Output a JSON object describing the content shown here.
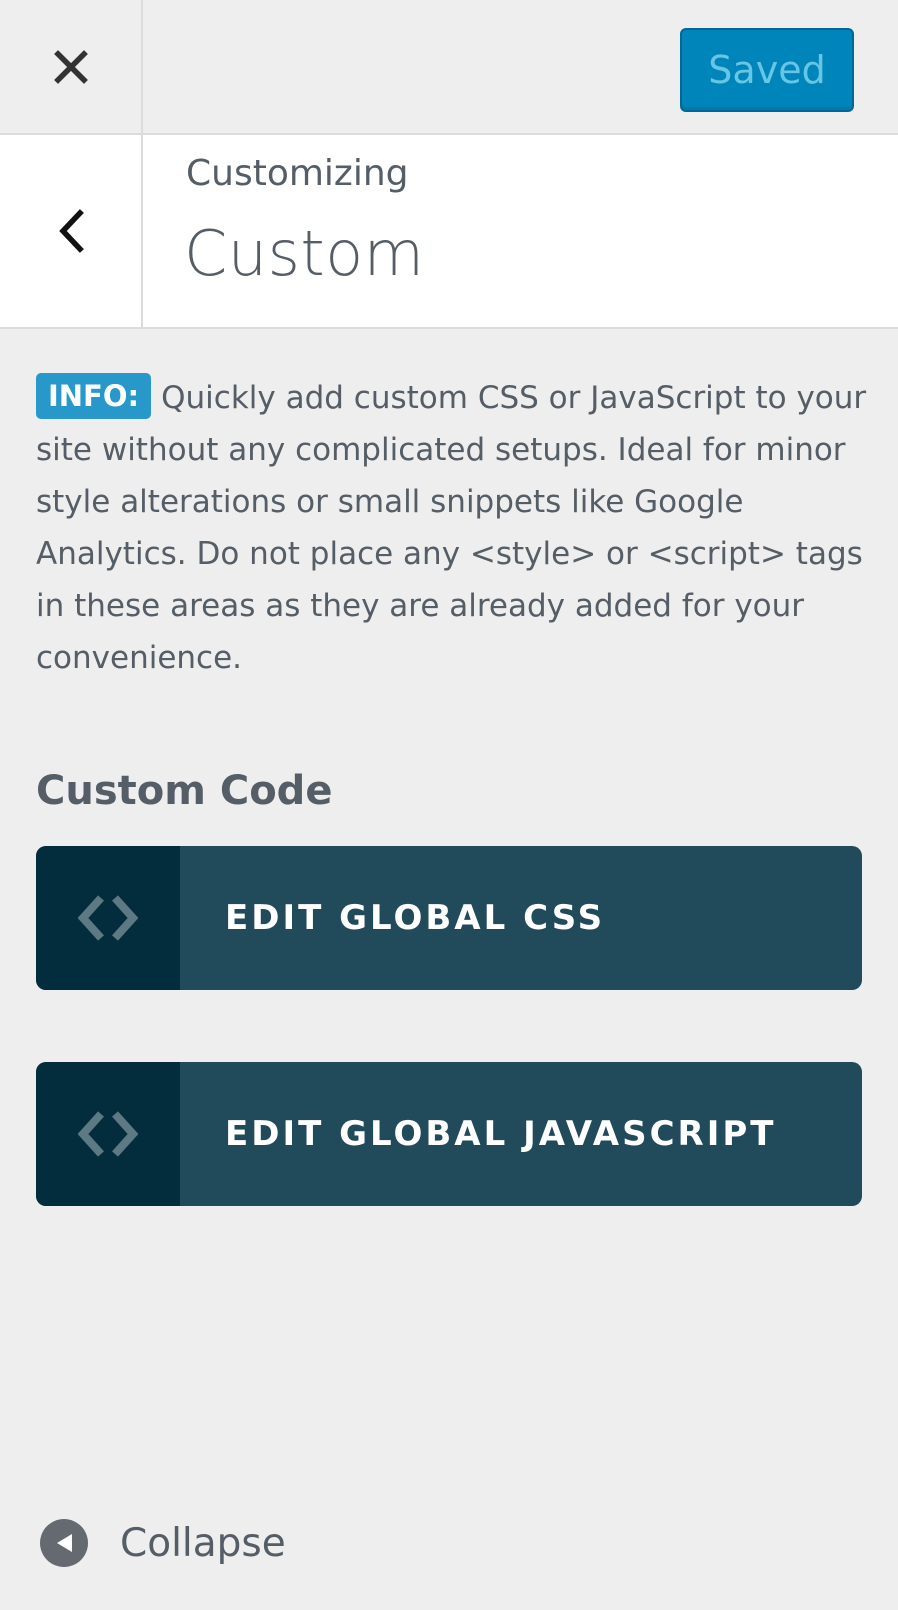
{
  "header": {
    "saved_label": "Saved",
    "close_icon": "close-icon"
  },
  "title": {
    "breadcrumb": "Customizing",
    "section": "Custom",
    "back_icon": "chevron-left-icon"
  },
  "info": {
    "badge": "INFO:",
    "text": "Quickly add custom CSS or JavaScript to your site without any complicated setups. Ideal for minor style alterations or small snippets like Google Analytics. Do not place any <style> or <script> tags in these areas as they are already added for your convenience."
  },
  "custom_code": {
    "heading": "Custom Code",
    "buttons": [
      {
        "label": "EDIT GLOBAL CSS",
        "icon": "code-icon"
      },
      {
        "label": "EDIT GLOBAL JAVASCRIPT",
        "icon": "code-icon"
      }
    ]
  },
  "footer": {
    "collapse_label": "Collapse",
    "collapse_icon": "collapse-left-icon"
  },
  "colors": {
    "primary_button": "#0085ba",
    "code_button_bg": "#214a5a",
    "code_button_icon_bg": "#032d3c",
    "info_badge": "#2798c9",
    "panel_bg": "#eeeeef"
  }
}
